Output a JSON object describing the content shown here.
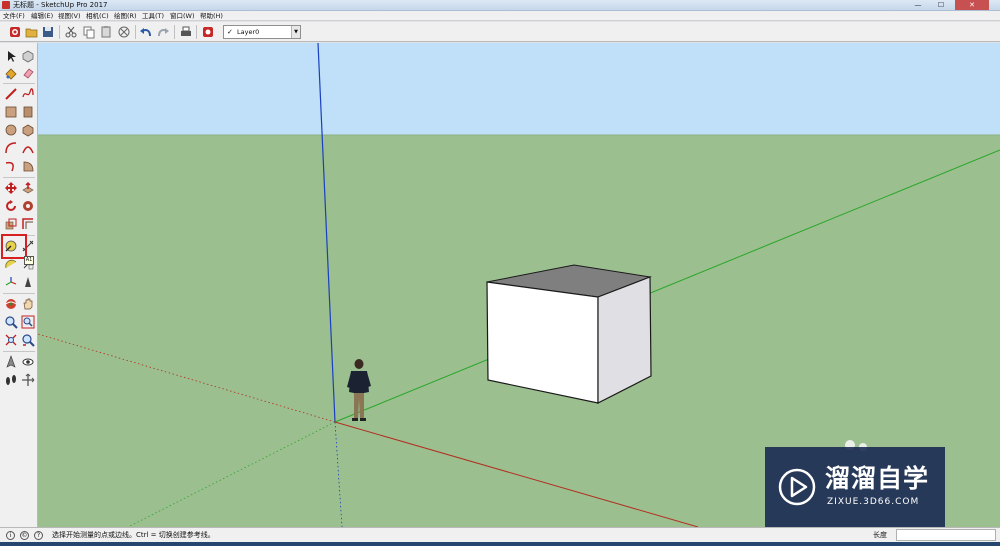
{
  "window": {
    "title": "无标题 - SketchUp Pro 2017",
    "controls": [
      "minimize-icon",
      "maximize-icon",
      "close-icon"
    ]
  },
  "menubar": {
    "items": [
      "文件(F)",
      "编辑(E)",
      "视图(V)",
      "相机(C)",
      "绘图(R)",
      "工具(T)",
      "窗口(W)",
      "帮助(H)"
    ]
  },
  "toolbar": {
    "buttons": [
      "new-icon",
      "open-icon",
      "save-icon",
      "cut-icon",
      "copy-icon",
      "paste-icon",
      "erase-icon",
      "undo-icon",
      "redo-icon",
      "print-icon",
      "model-info-icon"
    ],
    "layer": {
      "checked": "✓",
      "value": "Layer0"
    }
  },
  "left_toolbar": {
    "tools": [
      "select",
      "component",
      "paint-bucket",
      "eraser",
      "line",
      "freehand",
      "rectangle",
      "rotated-rectangle",
      "circle",
      "polygon",
      "arc",
      "2-point-arc",
      "3-point-arc",
      "pie",
      "move",
      "push-pull",
      "rotate",
      "follow-me",
      "scale",
      "offset",
      "tape-measure",
      "dimension",
      "protractor",
      "text",
      "axes",
      "3d-text",
      "orbit",
      "pan",
      "zoom",
      "zoom-window",
      "zoom-extents",
      "previous-view",
      "position-camera",
      "look-around",
      "walk",
      "section-plane"
    ],
    "active_tool": "tape-measure",
    "tooltip": "A1"
  },
  "viewport": {
    "colors": {
      "sky": "#bfe0f8",
      "ground": "#9cbf90",
      "axis_blue": "#1a3fbf",
      "axis_green": "#2aa62a",
      "axis_red": "#b03020",
      "box_top": "#7f7f7f",
      "box_front": "#ffffff",
      "box_side": "#e0e0e4"
    }
  },
  "status": {
    "help_text": "选择开始测量的点或边线。Ctrl = 切换创建参考线。",
    "measurements_label": "长度",
    "measurements_value": ""
  },
  "watermark": {
    "name": "溜溜自学",
    "url": "ZIXUE.3D66.COM"
  }
}
